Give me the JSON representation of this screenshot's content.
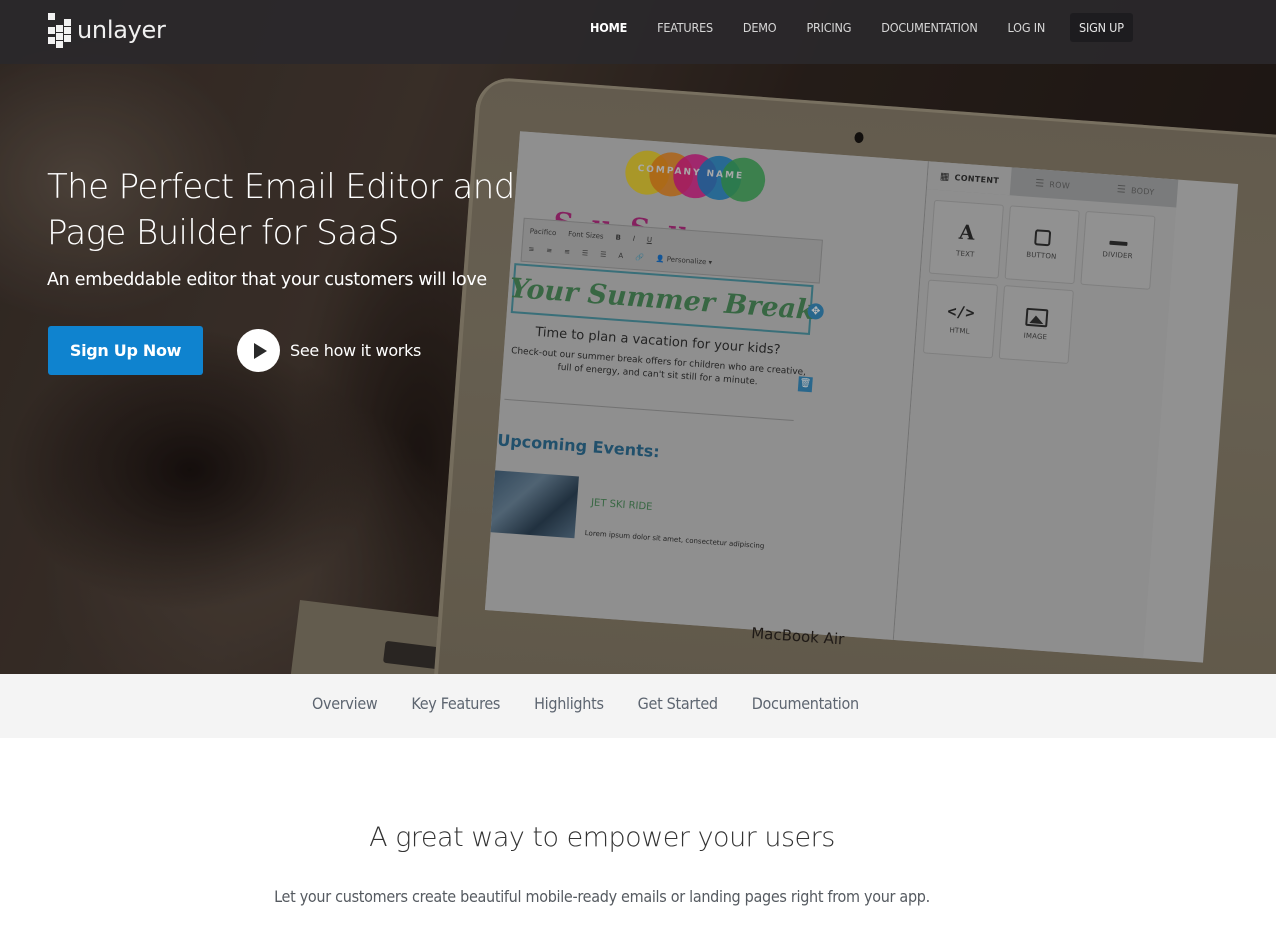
{
  "navbar": {
    "brand": "unlayer",
    "links": [
      {
        "label": "HOME",
        "active": true
      },
      {
        "label": "FEATURES"
      },
      {
        "label": "DEMO"
      },
      {
        "label": "PRICING"
      },
      {
        "label": "DOCUMENTATION"
      },
      {
        "label": "LOG IN"
      },
      {
        "label": "SIGN UP"
      }
    ]
  },
  "hero": {
    "title_line1": "The Perfect Email Editor and",
    "title_line2": "Page Builder for SaaS",
    "subtitle": "An embeddable editor that your customers will love",
    "cta_primary": "Sign Up Now",
    "cta_video": "See how it works",
    "laptop_label": "MacBook Air",
    "editor_mockup": {
      "company_name": "COMPANY NAME",
      "toolbar": {
        "font": "Pacifico",
        "font_sizes": "Font Sizes",
        "bold": "B",
        "italic": "I",
        "underline": "U",
        "personalize": "Personalize"
      },
      "headline": "Your Summer Break",
      "subheadline": "Time to plan a vacation for your kids?",
      "body_line1": "Check-out our summer break offers for children who are creative,",
      "body_line2": "full of energy, and can't sit still for a minute.",
      "events_title": "Upcoming Events:",
      "event_title": "JET SKI RIDE",
      "event_copy": "Lorem ipsum dolor sit amet, consectetur adipiscing",
      "panel_tabs": [
        {
          "label": "CONTENT",
          "icon": "grid-icon",
          "active": true
        },
        {
          "label": "ROW",
          "icon": "menu-icon"
        },
        {
          "label": "BODY",
          "icon": "menu-icon"
        }
      ],
      "tiles": [
        {
          "label": "TEXT",
          "icon": "text-icon",
          "glyph": "A"
        },
        {
          "label": "BUTTON",
          "icon": "button-icon"
        },
        {
          "label": "DIVIDER",
          "icon": "divider-icon"
        },
        {
          "label": "HTML",
          "icon": "code-icon",
          "glyph": "</>"
        },
        {
          "label": "IMAGE",
          "icon": "image-icon"
        }
      ],
      "logo_colors": [
        "#f0d21e",
        "#f08a1e",
        "#e21f8e",
        "#1e88cc",
        "#3fae5a"
      ]
    }
  },
  "subnav": {
    "links": [
      "Overview",
      "Key Features",
      "Highlights",
      "Get Started",
      "Documentation"
    ]
  },
  "intro": {
    "title": "A great way to empower your users",
    "subtitle": "Let your customers create beautiful mobile-ready emails or landing pages right from your app."
  },
  "colors": {
    "primary": "#0f83cf",
    "navbar_bg": "#2a282b",
    "subnav_bg": "#f4f4f4"
  }
}
